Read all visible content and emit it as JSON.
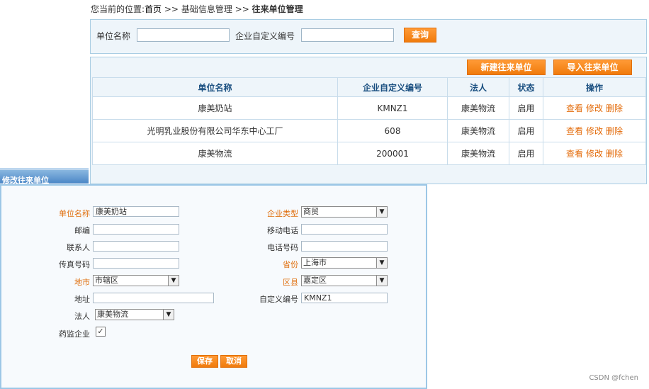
{
  "breadcrumb": {
    "prefix": "您当前的位置:",
    "home": "首页",
    "sep1": " >> ",
    "section": "基础信息管理",
    "sep2": " >> ",
    "current": "往来单位管理"
  },
  "search": {
    "name_label": "单位名称",
    "name_value": "",
    "code_label": "企业自定义编号",
    "code_value": "",
    "button": "查询"
  },
  "toolbar": {
    "new_button": "新建往来单位",
    "import_button": "导入往来单位"
  },
  "table": {
    "headers": [
      "单位名称",
      "企业自定义编号",
      "法人",
      "状态",
      "操作"
    ],
    "rows": [
      {
        "name": "康美奶站",
        "code": "KMNZ1",
        "legal": "康美物流",
        "status": "启用"
      },
      {
        "name": "光明乳业股份有限公司华东中心工厂",
        "code": "608",
        "legal": "康美物流",
        "status": "启用"
      },
      {
        "name": "康美物流",
        "code": "200001",
        "legal": "康美物流",
        "status": "启用"
      }
    ],
    "ops": {
      "view": "查看",
      "edit": "修改",
      "delete": "删除"
    }
  },
  "dialog": {
    "title": "修改往来单位",
    "fields": {
      "unit_name": {
        "label": "单位名称",
        "value": "康美奶站"
      },
      "company_type": {
        "label": "企业类型",
        "value": "商贸"
      },
      "postcode": {
        "label": "邮编",
        "value": ""
      },
      "mobile": {
        "label": "移动电话",
        "value": ""
      },
      "contact": {
        "label": "联系人",
        "value": ""
      },
      "phone": {
        "label": "电话号码",
        "value": ""
      },
      "fax": {
        "label": "传真号码",
        "value": ""
      },
      "province": {
        "label": "省份",
        "value": "上海市"
      },
      "city": {
        "label": "地市",
        "value": "市辖区"
      },
      "district": {
        "label": "区县",
        "value": "嘉定区"
      },
      "address": {
        "label": "地址",
        "value": ""
      },
      "custom_code": {
        "label": "自定义编号",
        "value": "KMNZ1"
      },
      "legal": {
        "label": "法人",
        "value": "康美物流"
      },
      "drug_reg": {
        "label": "药监企业",
        "checked": true
      }
    },
    "save_button": "保存",
    "cancel_button": "取消"
  },
  "watermark": "CSDN @fchen"
}
